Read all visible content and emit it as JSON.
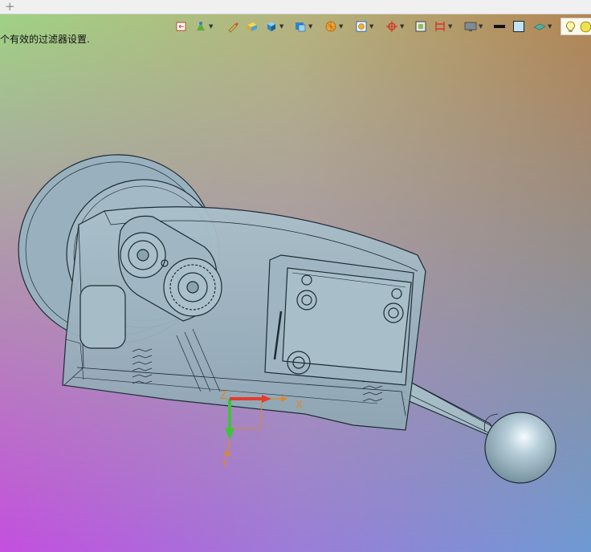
{
  "tabs": {
    "add_symbol": "+"
  },
  "status": {
    "text": "个有效的过滤器设置."
  },
  "toolbar": {
    "buttons": [
      {
        "name": "fit-view-icon",
        "dropdown": false
      },
      {
        "name": "render-mode-icon",
        "dropdown": true
      },
      {
        "name": "pencil-icon",
        "dropdown": false
      },
      {
        "name": "box-icon",
        "dropdown": false
      },
      {
        "name": "cube-icon",
        "dropdown": true
      },
      {
        "name": "view-orientation-icon",
        "dropdown": true
      },
      {
        "name": "sphere-icon",
        "dropdown": true
      },
      {
        "name": "section-view-icon",
        "dropdown": true
      },
      {
        "name": "snap-point-icon",
        "dropdown": true
      },
      {
        "name": "frame-icon",
        "dropdown": false
      },
      {
        "name": "clip-icon",
        "dropdown": true
      },
      {
        "name": "display-icon",
        "dropdown": true
      },
      {
        "name": "line-width-icon",
        "dropdown": false
      },
      {
        "name": "color-swatch-icon",
        "dropdown": false
      },
      {
        "name": "shading-icon",
        "dropdown": true
      },
      {
        "name": "light-bulb-icon",
        "dropdown": false
      }
    ]
  },
  "colors": {
    "bg_top_left": "#9fd284",
    "bg_top_right": "#b38553",
    "bg_bottom_left": "#c44fdf",
    "bg_bottom_right": "#6f9ad4",
    "model_fill": "#9bb3c0",
    "model_edge": "#1d2b34",
    "axis_x": "#e53b2b",
    "axis_y": "#3ec43a",
    "axis_label": "#d88a2a"
  },
  "triad": {
    "x_label": "X",
    "y_label": "Y",
    "z_label": "Z"
  }
}
